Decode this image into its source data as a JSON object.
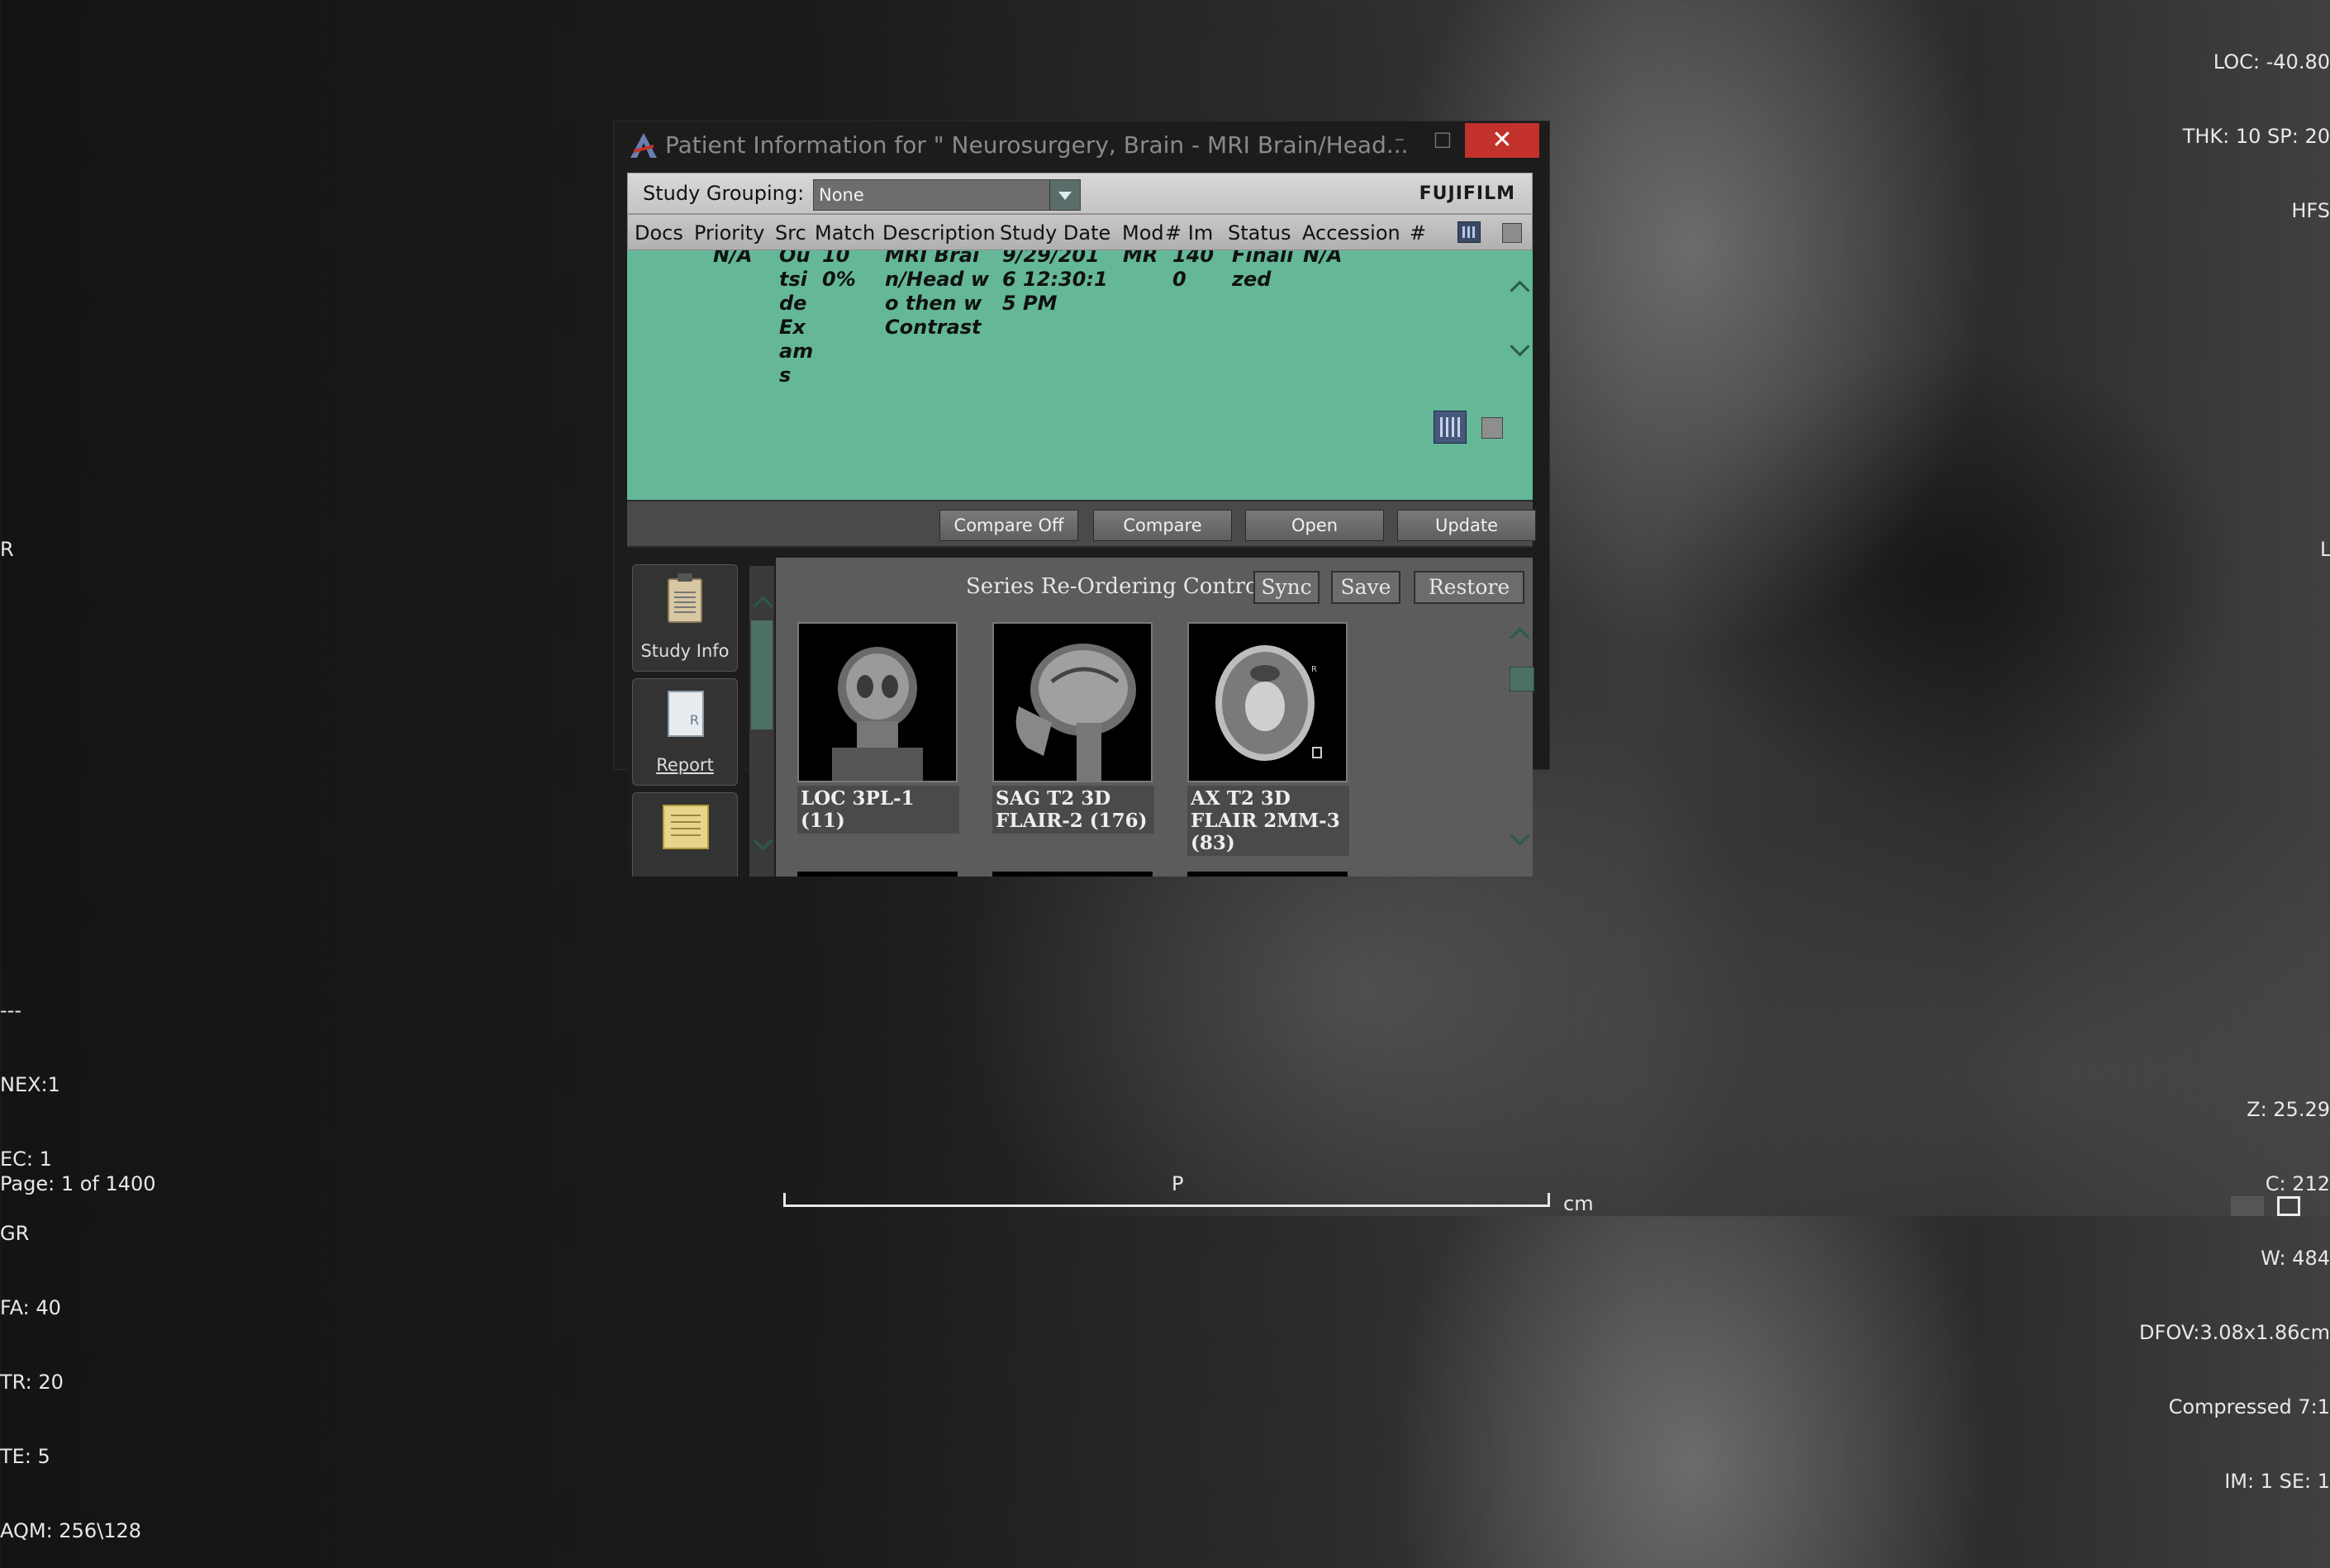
{
  "overlay": {
    "top_right": [
      "LOC: -40.80",
      "THK: 10 SP: 20",
      "HFS"
    ],
    "left_marker": "R",
    "right_marker": "L",
    "bottom_left": [
      "---",
      "NEX:1",
      "EC: 1",
      "GR",
      "FA: 40",
      "TR: 20",
      "TE: 5",
      "AQM: 256\\128"
    ],
    "page": "Page: 1 of 1400",
    "bottom_center": "P",
    "scale_unit": "cm",
    "bottom_right": [
      "Z: 25.29",
      "C: 212",
      "W: 484",
      "DFOV:3.08x1.86cm",
      "Compressed 7:1",
      "IM: 1 SE: 1"
    ]
  },
  "dialog": {
    "title": "Patient Information for \" Neurosurgery, Brain  - MRI Brain/Head...",
    "minimize": "–",
    "maximize": "□",
    "close": "✕",
    "grouping_label": "Study Grouping:",
    "grouping_value": "None",
    "brand": "FUJIFILM",
    "columns": [
      "Docs",
      "Priority",
      "Src",
      "Match",
      "Description",
      "Study Date",
      "Mod",
      "# Im",
      "Status",
      "Accession",
      "#"
    ],
    "study_row": {
      "priority": "N/A",
      "src": [
        "Ou",
        "tsi",
        "de",
        "Ex",
        "am",
        "s"
      ],
      "match": [
        "10",
        "0%"
      ],
      "description": [
        "MRI Brai",
        "n/Head w",
        "o then w",
        "Contrast"
      ],
      "study_date": [
        "9/29/201",
        "6 12:30:1",
        "5 PM"
      ],
      "mod": "MR",
      "num_images": [
        "140",
        "0"
      ],
      "status": [
        "Finali",
        "zed"
      ],
      "accession": "N/A"
    },
    "actions": [
      "Compare Off",
      "Compare",
      "Open",
      "Update"
    ],
    "side_buttons": [
      "Study Info",
      "Report",
      ""
    ],
    "reorder_label": "Series Re-Ordering Controls:",
    "reorder_buttons": [
      "Sync",
      "Save",
      "Restore"
    ],
    "series": [
      {
        "label": "LOC 3PL-1 (11)",
        "view": "coronal"
      },
      {
        "label": "SAG T2 3D FLAIR-2 (176)",
        "view": "sagittal"
      },
      {
        "label": "AX T2 3D FLAIR 2MM-3 (83)",
        "view": "axial"
      }
    ]
  },
  "colors": {
    "row_selected": "#64b898",
    "close_button": "#c2312b",
    "scroll_thumb": "#4c7066"
  }
}
